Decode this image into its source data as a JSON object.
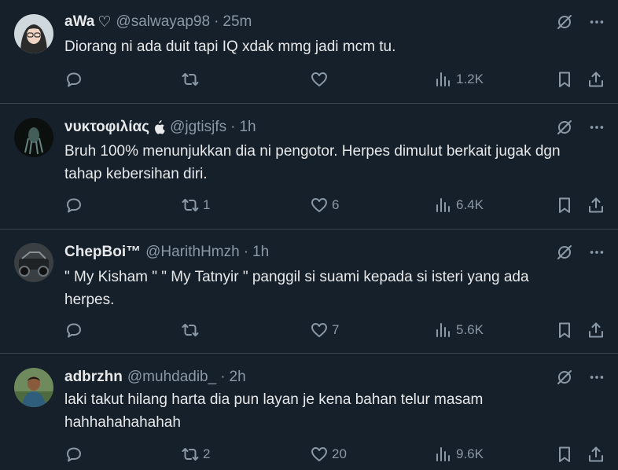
{
  "tweets": [
    {
      "name": "aWa",
      "name_extra": "♡",
      "handle": "@salwayap98",
      "time": "25m",
      "text": "Diorang ni ada duit tapi IQ xdak mmg jadi mcm tu.",
      "reply_count": "",
      "retweet_count": "",
      "like_count": "",
      "views": "1.2K"
    },
    {
      "name": "νυκτοφιλίας",
      "name_extra": "",
      "handle": "@jgtisjfs",
      "time": "1h",
      "text": "Bruh 100% menunjukkan dia ni pengotor. Herpes dimulut berkait jugak dgn tahap kebersihan diri.",
      "reply_count": "",
      "retweet_count": "1",
      "like_count": "6",
      "views": "6.4K"
    },
    {
      "name": "ChepBoi™",
      "name_extra": "",
      "handle": "@HarithHmzh",
      "time": "1h",
      "text": "\" My Kisham \" \" My Tatnyir \" panggil si suami kepada si isteri yang ada herpes.",
      "reply_count": "",
      "retweet_count": "",
      "like_count": "7",
      "views": "5.6K"
    },
    {
      "name": "adbrzhn",
      "name_extra": "",
      "handle": "@muhdadib_",
      "time": "2h",
      "text": "laki takut hilang harta dia pun layan je kena bahan telur masam hahhahahahahah",
      "reply_count": "",
      "retweet_count": "2",
      "like_count": "20",
      "views": "9.6K"
    }
  ],
  "separator": "·",
  "colors": {
    "background": "#15202b",
    "text": "#e7e9ea",
    "muted": "#8b98a5",
    "border": "#38444d"
  }
}
